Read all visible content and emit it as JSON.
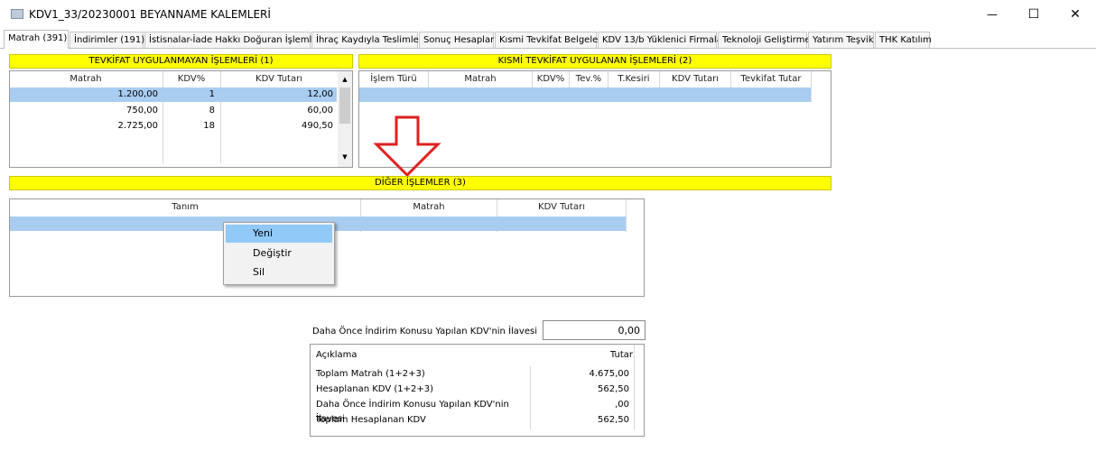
{
  "window": {
    "title": "KDV1_33/20230001 BEYANNAME KALEMLERİ",
    "minimize_glyph": "—",
    "maximize_glyph": "☐",
    "close_glyph": "✕"
  },
  "tabs": [
    {
      "label": "Matrah (391)",
      "active": true
    },
    {
      "label": "İndirimler (191)"
    },
    {
      "label": "İstisnalar-İade Hakkı Doğuran İşlemler"
    },
    {
      "label": "İhraç Kaydıyla Teslimler"
    },
    {
      "label": "Sonuç Hesapları"
    },
    {
      "label": "Kısmi Tevkifat Belgeleri"
    },
    {
      "label": "KDV 13/b Yüklenici Firmalar"
    },
    {
      "label": "Teknoloji Geliştirme"
    },
    {
      "label": "Yatırım Teşvik"
    },
    {
      "label": "THK Katılım"
    }
  ],
  "tevkifat_uygulanmayan": {
    "header": "TEVKİFAT UYGULANMAYAN İŞLEMLERİ (1)",
    "columns": [
      "Matrah",
      "KDV%",
      "KDV Tutarı"
    ],
    "rows": [
      [
        "1.200,00",
        "1",
        "12,00"
      ],
      [
        "750,00",
        "8",
        "60,00"
      ],
      [
        "2.725,00",
        "18",
        "490,50"
      ]
    ],
    "scroll_up": "▲",
    "scroll_down": "▼"
  },
  "kismi_tevkifat": {
    "header": "KISMİ TEVKİFAT UYGULANAN İŞLEMLERİ (2)",
    "columns": [
      "İşlem Türü",
      "Matrah",
      "KDV%",
      "Tev.%",
      "T.Kesiri",
      "KDV Tutarı",
      "Tevkifat Tutar"
    ]
  },
  "diger_islemler": {
    "header": "DİĞER İŞLEMLER (3)",
    "columns": [
      "Tanım",
      "Matrah",
      "KDV Tutarı"
    ]
  },
  "context_menu": {
    "items": [
      "Yeni",
      "Değiştir",
      "Sil"
    ]
  },
  "ilave": {
    "label": "Daha Önce İndirim Konusu Yapılan KDV'nin İlavesi",
    "value": "0,00"
  },
  "summary": {
    "columns": [
      "Açıklama",
      "Tutar"
    ],
    "rows": [
      [
        "Toplam Matrah (1+2+3)",
        "4.675,00"
      ],
      [
        "Hesaplanan KDV (1+2+3)",
        "562,50"
      ],
      [
        "Daha Önce İndirim Konusu Yapılan KDV'nin İlavesi",
        ",00"
      ],
      [
        "Toplam Hesaplanan KDV",
        "562,50"
      ]
    ]
  },
  "colors": {
    "section_header": "#ffff00",
    "selected_row": "#a8cdf0",
    "menu_highlight": "#91c9f7",
    "arrow": "#e02020"
  }
}
